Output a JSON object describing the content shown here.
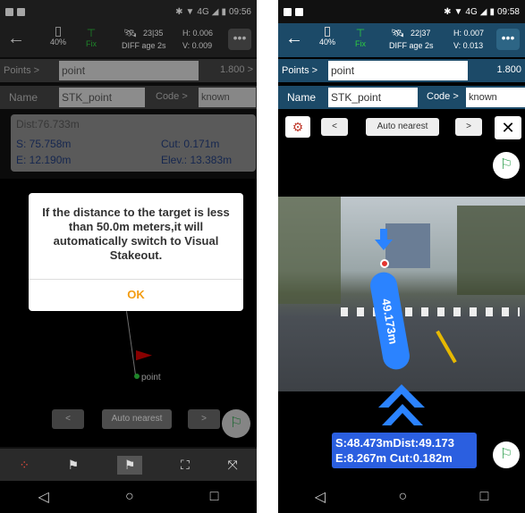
{
  "status": {
    "time": "09:56",
    "net": "4G"
  },
  "left": {
    "battery": "40%",
    "fix": "Fix",
    "sats": "23|35",
    "diff": "DIFF age 2s",
    "h": "H: 0.006",
    "v": "V: 0.009",
    "points_label": "Points >",
    "points_value": "point",
    "pole": "1.800 >",
    "name_label": "Name",
    "name_value": "STK_point",
    "code_label": "Code >",
    "code_value": "known",
    "dist": "Dist:76.733m",
    "s": "S: 75.758m",
    "cut": "Cut: 0.171m",
    "e": "E: 12.190m",
    "elev": "Elev.: 13.383m",
    "dialog_text": "If the distance to the target is less than 50.0m meters,it will automatically switch to Visual Stakeout.",
    "ok": "OK",
    "target": "point",
    "auto": "Auto nearest",
    "prev": "<",
    "next": ">"
  },
  "right": {
    "time": "09:58",
    "battery": "40%",
    "fix": "Fix",
    "sats": "22|37",
    "diff": "DIFF age 2s",
    "h": "H: 0.007",
    "v": "V: 0.013",
    "points_label": "Points >",
    "points_value": "point",
    "pole": "1.800",
    "name_label": "Name",
    "name_value": "STK_point",
    "code_label": "Code >",
    "code_value": "known",
    "auto": "Auto nearest",
    "prev": "<",
    "next": ">",
    "close": "✕",
    "ar_dist": "49.173m",
    "info1": "S:48.473mDist:49.173",
    "info2": "E:8.267m  Cut:0.182m"
  },
  "nav": {
    "back": "◁",
    "home": "○",
    "recent": "□"
  }
}
